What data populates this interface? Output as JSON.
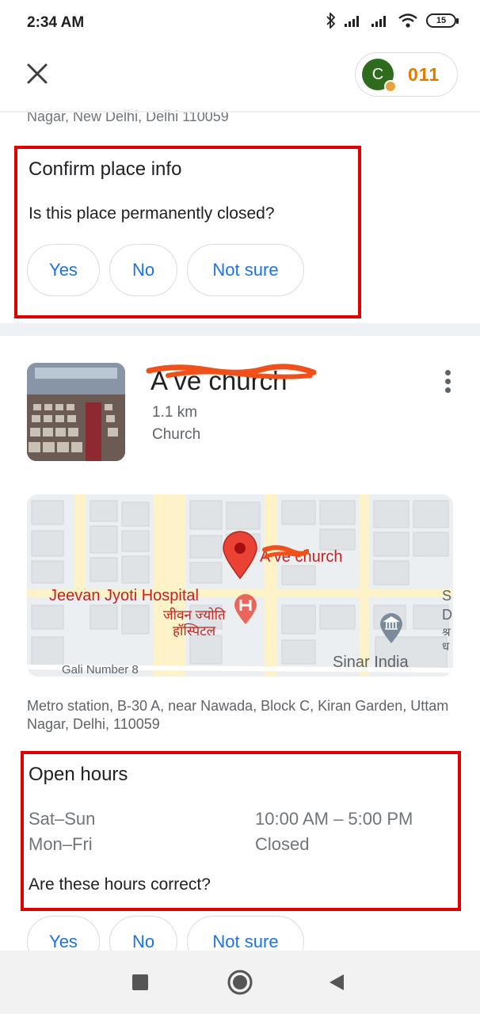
{
  "status": {
    "time": "2:34 AM",
    "battery": "15",
    "icons": [
      "bluetooth-icon",
      "signal-icon",
      "signal-icon",
      "wifi-icon",
      "battery-icon"
    ]
  },
  "header": {
    "close_icon": "close-icon",
    "avatar_letter": "C",
    "points": "011"
  },
  "previous_address": "Nagar, New Delhi, Delhi 110059",
  "confirm_card": {
    "title": "Confirm place info",
    "question": "Is this place permanently closed?",
    "options": [
      "Yes",
      "No",
      "Not sure"
    ]
  },
  "place": {
    "name": "A    ve church",
    "distance": "1.1 km",
    "category": "Church"
  },
  "map": {
    "pin_label": "A    ve church",
    "hospital_en": "Jeevan Jyoti Hospital",
    "hospital_hi_line1": "जीवन ज्योति",
    "hospital_hi_line2": "हॉस्पिटल",
    "street": "Gali Number 8",
    "poi": "Sinar India",
    "edge_text_1": "S",
    "edge_text_2": "D",
    "edge_text_3": "श्र",
    "edge_text_4": "ध"
  },
  "full_address": "Metro station, B-30 A, near Nawada, Block C, Kiran Garden, Uttam Nagar, Delhi, 110059",
  "hours_card": {
    "title": "Open hours",
    "rows": [
      {
        "days": "Sat–Sun",
        "hours": "10:00 AM – 5:00 PM"
      },
      {
        "days": "Mon–Fri",
        "hours": "Closed"
      }
    ],
    "question": "Are these hours correct?"
  },
  "bottom_options": [
    "Yes",
    "No",
    "Not sure"
  ],
  "colors": {
    "accent": "#1a73e8",
    "highlight_box": "#e00000",
    "points": "#e07b00",
    "map_red": "#c5221f"
  }
}
